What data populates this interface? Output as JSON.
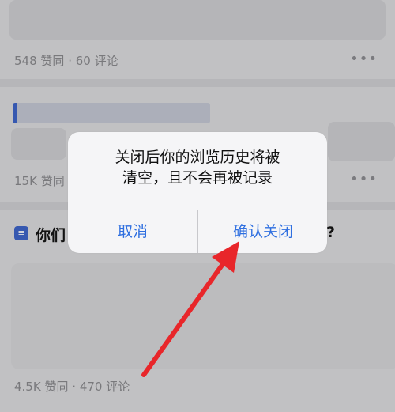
{
  "feed": {
    "card1": {
      "likes": "548 赞同",
      "dot": "·",
      "comments": "60 评论",
      "more": "•••"
    },
    "card2": {
      "likes": "15K 赞同",
      "more": "•••"
    },
    "card3": {
      "title_left": "你们",
      "title_right": "?",
      "likes": "4.5K 赞同",
      "dot": "·",
      "comments": "470 评论"
    }
  },
  "dialog": {
    "message_line1": "关闭后你的浏览历史将被",
    "message_line2": "清空，且不会再被记录",
    "cancel_label": "取消",
    "confirm_label": "确认关闭"
  },
  "colors": {
    "accent": "#2f6fe0",
    "arrow": "#e8262a",
    "question_icon": "#3e65c9"
  },
  "icons": {
    "question": "article-icon",
    "more": "more-horizontal-icon"
  }
}
